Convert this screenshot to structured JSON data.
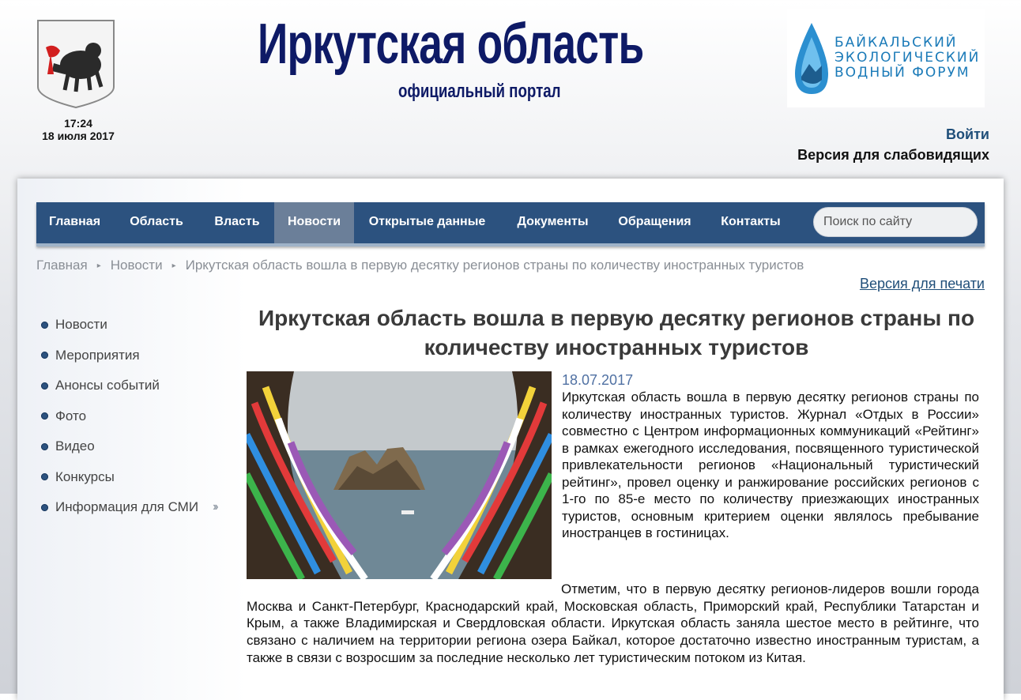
{
  "header": {
    "time": "17:24",
    "date": "18 июля 2017",
    "title": "Иркутская область",
    "subtitle": "официальный портал",
    "forum_banner": [
      "БАЙКАЛЬСКИЙ",
      "ЭКОЛОГИЧЕСКИЙ",
      "ВОДНЫЙ ФОРУМ"
    ],
    "login_label": "Войти",
    "low_vision_label": "Версия для слабовидящих"
  },
  "nav": {
    "items": [
      {
        "label": "Главная"
      },
      {
        "label": "Область"
      },
      {
        "label": "Власть"
      },
      {
        "label": "Новости",
        "active": true
      },
      {
        "label": "Открытые данные"
      },
      {
        "label": "Документы"
      },
      {
        "label": "Обращения"
      },
      {
        "label": "Контакты"
      }
    ],
    "search_placeholder": "Поиск по сайту"
  },
  "breadcrumb": [
    "Главная",
    "Новости",
    "Иркутская область вошла в первую десятку регионов страны по количеству иностранных туристов"
  ],
  "print_label": "Версия для печати",
  "sidebar": {
    "items": [
      {
        "label": "Новости"
      },
      {
        "label": "Мероприятия"
      },
      {
        "label": "Анонсы событий"
      },
      {
        "label": "Фото"
      },
      {
        "label": "Видео"
      },
      {
        "label": "Конкурсы"
      },
      {
        "label": "Информация для СМИ",
        "expandable": true
      }
    ]
  },
  "article": {
    "title": "Иркутская область вошла в первую десятку регионов страны по количеству иностранных туристов",
    "date": "18.07.2017",
    "lead": "Иркутская область вошла в первую десятку регионов страны по количеству иностранных туристов. Журнал «Отдых в России» совместно с Центром информационных коммуникаций «Рейтинг» в рамках ежегодного исследования, посвященного туристической привлекательности регионов «Национальный туристический рейтинг», провел оценку и ранжирование российских регионов с 1-го по 85-е место по количеству приезжающих иностранных туристов, основным критерием оценки являлось пребывание иностранцев в гостиницах.",
    "paragraph": "Отметим, что в первую десятку регионов-лидеров вошли города Москва и Санкт-Петербург, Краснодарский край, Московская область, Приморский край, Республики Татарстан  и Крым, а также Владимирская и Свердловская области. Иркутская область заняла шестое место в рейтинге, что связано с наличием на территории региона озера Байкал, которое достаточно известно иностранным туристам, а также в связи с возросшим за последние несколько лет туристическим потоком из Китая."
  },
  "colors": {
    "nav_bg": "#2c527f",
    "nav_active": "#6b7f99",
    "title_blue": "#0e1a66",
    "link_blue": "#1f4e79",
    "date_blue": "#5071a3"
  }
}
